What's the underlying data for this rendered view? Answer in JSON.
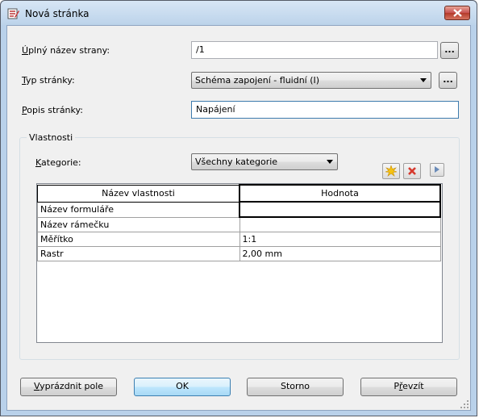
{
  "window": {
    "title": "Nová stránka"
  },
  "fields": {
    "full_name": {
      "label_accel": "Ú",
      "label_rest": "plný název strany:",
      "value": "/1",
      "browse": "..."
    },
    "page_type": {
      "label_accel": "T",
      "label_rest": "yp stránky:",
      "value": "Schéma zapojení - fluidní (I)",
      "browse": "..."
    },
    "description": {
      "label_accel": "P",
      "label_rest": "opis stránky:",
      "value": "Napájení"
    }
  },
  "properties": {
    "group_title": "Vlastnosti",
    "category": {
      "label_accel": "K",
      "label_rest": "ategorie:",
      "value": "Všechny kategorie"
    },
    "table": {
      "headers": [
        "Název vlastnosti",
        "Hodnota"
      ],
      "rows": [
        {
          "name": "Název formuláře",
          "value": ""
        },
        {
          "name": "Název rámečku",
          "value": ""
        },
        {
          "name": "Měřítko",
          "value": "1:1"
        },
        {
          "name": "Rastr",
          "value": "2,00 mm"
        }
      ]
    }
  },
  "buttons": {
    "clear": {
      "accel": "V",
      "rest": "yprázdnit pole"
    },
    "ok": "OK",
    "cancel": "Storno",
    "apply": {
      "pre": "P",
      "accel": "ř",
      "rest": "evzít"
    }
  },
  "colors": {
    "titlebar": "#c7dcf0",
    "client": "#f0f0f0",
    "close": "#c75050"
  }
}
